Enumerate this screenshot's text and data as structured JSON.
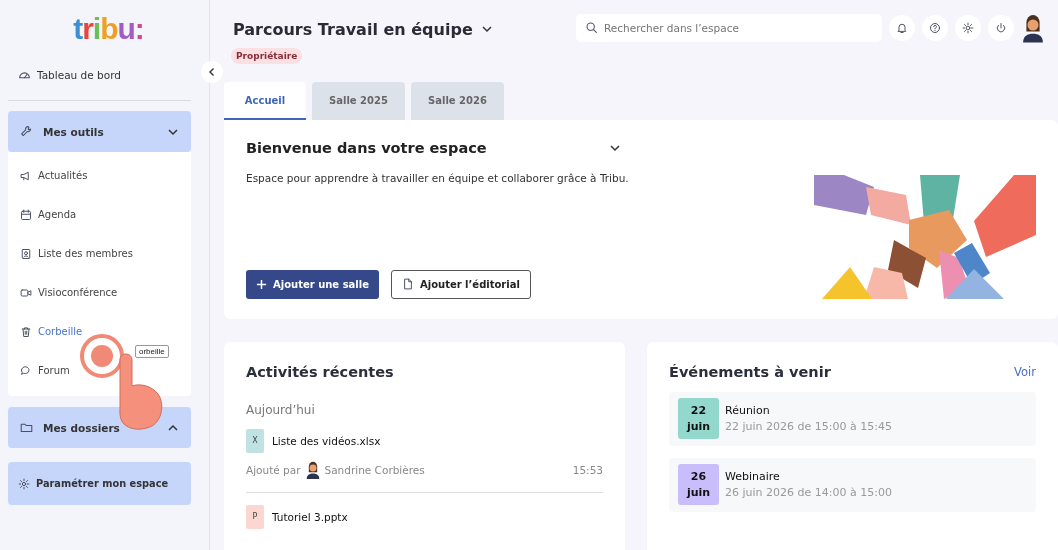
{
  "logo": {
    "text": "tribu:"
  },
  "sidebar": {
    "dashboard": "Tableau de bord",
    "groups": [
      {
        "label": "Mes outils",
        "expanded": true,
        "items": [
          {
            "label": "Actualités",
            "selected": false
          },
          {
            "label": "Agenda",
            "selected": false
          },
          {
            "label": "Liste des membres",
            "selected": false
          },
          {
            "label": "Visioconférence",
            "selected": false
          },
          {
            "label": "Corbeille",
            "selected": true
          },
          {
            "label": "Forum",
            "selected": false
          }
        ]
      },
      {
        "label": "Mes dossiers",
        "expanded": false
      }
    ],
    "settings": "Paramétrer mon espace"
  },
  "tooltip": "orbeille",
  "header": {
    "title": "Parcours Travail en équipe",
    "role_badge": "Propriétaire",
    "search": {
      "placeholder": "Rechercher dans l’espace"
    }
  },
  "tabs": [
    {
      "label": "Accueil",
      "selected": true
    },
    {
      "label": "Salle 2025",
      "selected": false
    },
    {
      "label": "Salle 2026",
      "selected": false
    }
  ],
  "welcome": {
    "title": "Bienvenue dans votre espace",
    "description": "Espace pour apprendre à travailler en équipe et collaborer grâce à Tribu.",
    "buttons": [
      {
        "label": "Ajouter une salle",
        "kind": "primary"
      },
      {
        "label": "Ajouter l’éditorial",
        "kind": "secondary"
      }
    ]
  },
  "activities": {
    "title": "Activités récentes",
    "day": "Aujourd’hui",
    "items": [
      {
        "badge": "X",
        "color": "#bfe3e3",
        "name": "Liste des vidéos.xlsx",
        "added_by": "Ajouté par",
        "author": "Sandrine Corbières",
        "time": "15:53"
      },
      {
        "badge": "P",
        "color": "#fcd6d0",
        "name": "Tutoriel 3.pptx"
      }
    ]
  },
  "events": {
    "title": "Événements à venir",
    "link": "Voir",
    "items": [
      {
        "day": "22",
        "month": "juin",
        "color": "#93d8cd",
        "title": "Réunion",
        "when": "22 juin 2026 de 15:00 à 15:45"
      },
      {
        "day": "26",
        "month": "juin",
        "color": "#c9bdfb",
        "title": "Webinaire",
        "when": "26 juin 2026 de 14:00 à 15:00"
      }
    ]
  }
}
